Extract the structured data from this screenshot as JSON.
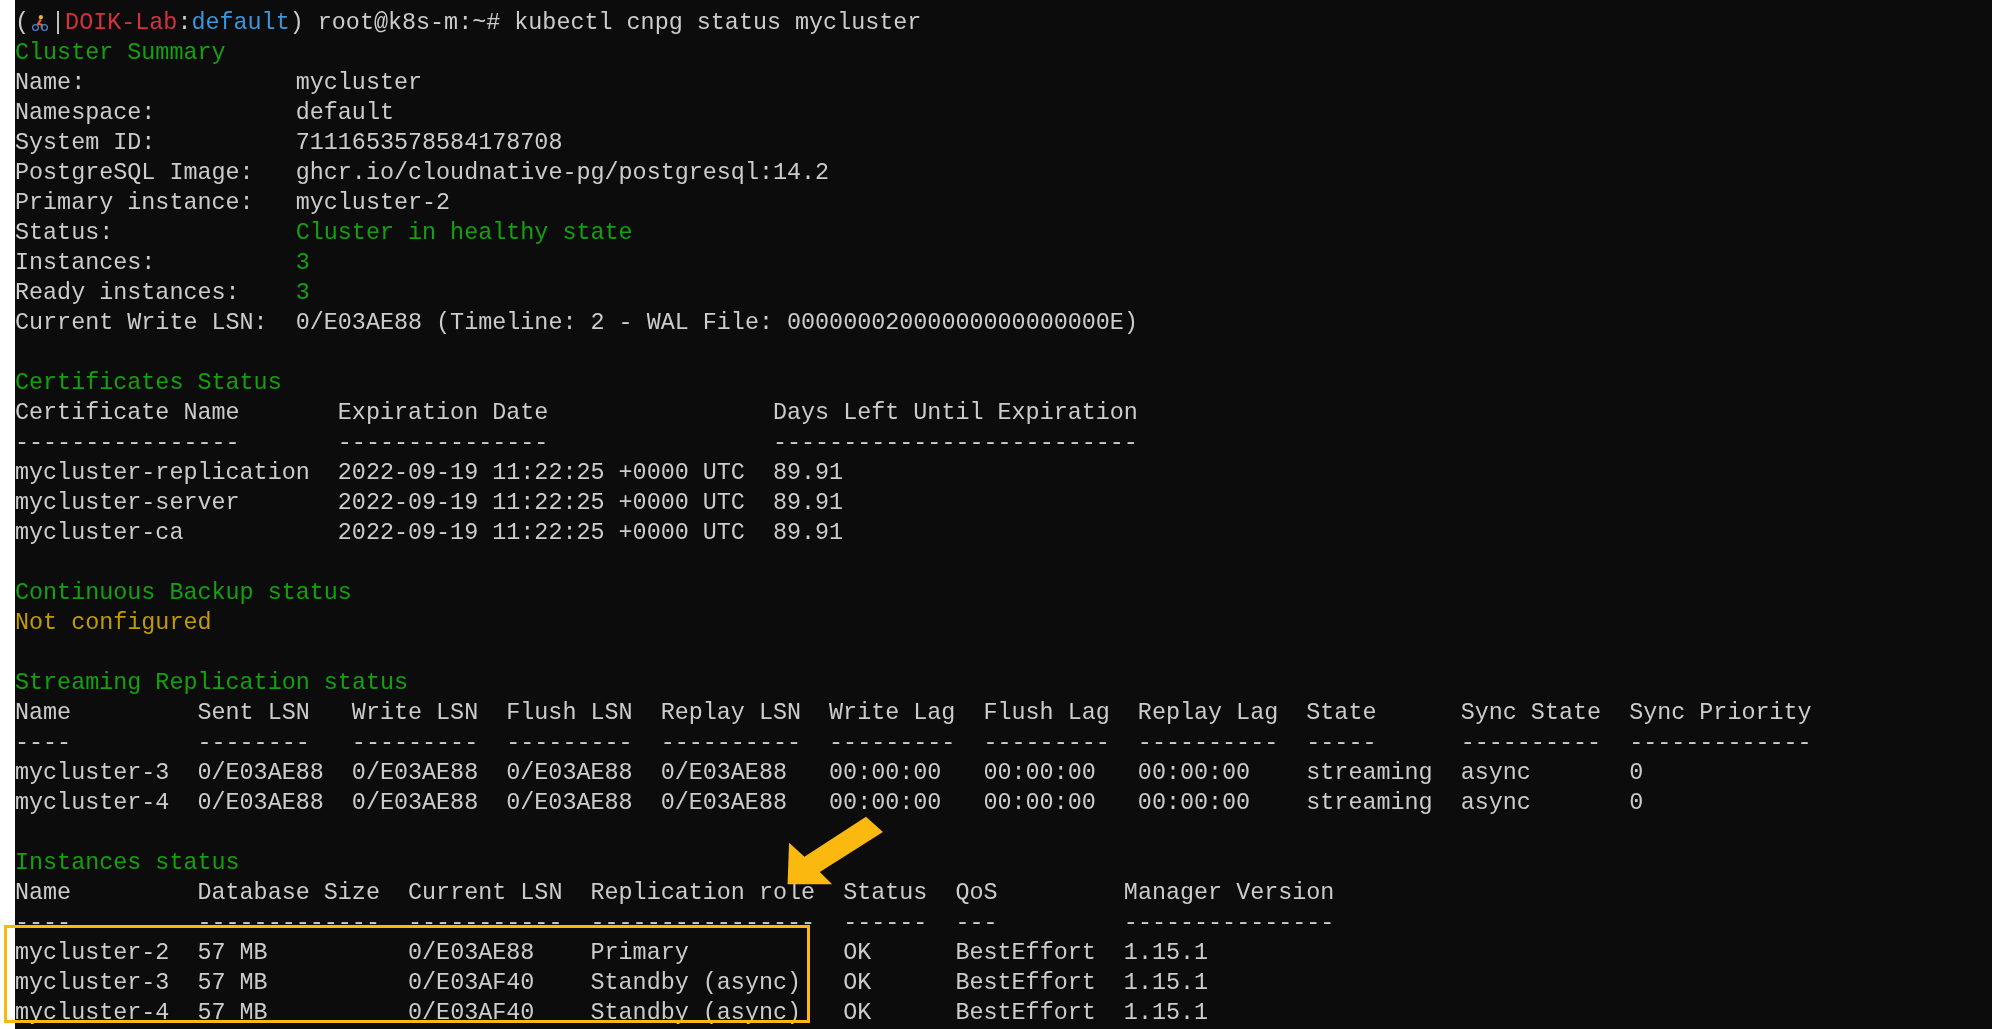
{
  "prompt": {
    "segments": [
      {
        "kind": "plain",
        "text": "("
      },
      {
        "kind": "icon"
      },
      {
        "kind": "plain",
        "text": "|"
      },
      {
        "kind": "host",
        "text": "DOIK-Lab"
      },
      {
        "kind": "plain",
        "text": ":"
      },
      {
        "kind": "namespace",
        "text": "default"
      },
      {
        "kind": "plain",
        "text": ") root@k8s-m:~# kubectl cnpg status mycluster"
      }
    ]
  },
  "sections": [
    {
      "title": "Cluster Summary",
      "kind": "fields",
      "fields": [
        {
          "label": "Name:",
          "value": "mycluster",
          "kind": "plain"
        },
        {
          "label": "Namespace:",
          "value": "default",
          "kind": "plain"
        },
        {
          "label": "System ID:",
          "value": "7111653578584178708",
          "kind": "plain"
        },
        {
          "label": "PostgreSQL Image:",
          "value": "ghcr.io/cloudnative-pg/postgresql:14.2",
          "kind": "plain"
        },
        {
          "label": "Primary instance:",
          "value": "mycluster-2",
          "kind": "plain"
        },
        {
          "label": "Status:",
          "value": "Cluster in healthy state",
          "kind": "good"
        },
        {
          "label": "Instances:",
          "value": "3",
          "kind": "good"
        },
        {
          "label": "Ready instances:",
          "value": "3",
          "kind": "good"
        },
        {
          "label": "Current Write LSN:",
          "value": "0/E03AE88 (Timeline: 2 - WAL File: 00000002000000000000000E)",
          "kind": "plain"
        }
      ]
    },
    {
      "title": "Certificates Status",
      "kind": "table",
      "columns": [
        {
          "label": "Certificate Name",
          "rule": "----------------"
        },
        {
          "label": "Expiration Date",
          "rule": "---------------"
        },
        {
          "label": "Days Left Until Expiration",
          "rule": "--------------------------"
        }
      ],
      "rows": [
        [
          "mycluster-replication",
          "2022-09-19 11:22:25 +0000 UTC",
          "89.91"
        ],
        [
          "mycluster-server",
          "2022-09-19 11:22:25 +0000 UTC",
          "89.91"
        ],
        [
          "mycluster-ca",
          "2022-09-19 11:22:25 +0000 UTC",
          "89.91"
        ]
      ]
    },
    {
      "title": "Continuous Backup status",
      "kind": "message",
      "message": {
        "text": "Not configured",
        "kind": "warning"
      }
    },
    {
      "title": "Streaming Replication status",
      "kind": "table",
      "columns": [
        {
          "label": "Name",
          "rule": "----"
        },
        {
          "label": "Sent LSN",
          "rule": "--------"
        },
        {
          "label": "Write LSN",
          "rule": "---------"
        },
        {
          "label": "Flush LSN",
          "rule": "---------"
        },
        {
          "label": "Replay LSN",
          "rule": "----------"
        },
        {
          "label": "Write Lag",
          "rule": "---------"
        },
        {
          "label": "Flush Lag",
          "rule": "---------"
        },
        {
          "label": "Replay Lag",
          "rule": "----------"
        },
        {
          "label": "State",
          "rule": "-----"
        },
        {
          "label": "Sync State",
          "rule": "----------"
        },
        {
          "label": "Sync Priority",
          "rule": "-------------"
        }
      ],
      "rows": [
        [
          "mycluster-3",
          "0/E03AE88",
          "0/E03AE88",
          "0/E03AE88",
          "0/E03AE88",
          "00:00:00",
          "00:00:00",
          "00:00:00",
          "streaming",
          "async",
          "0"
        ],
        [
          "mycluster-4",
          "0/E03AE88",
          "0/E03AE88",
          "0/E03AE88",
          "0/E03AE88",
          "00:00:00",
          "00:00:00",
          "00:00:00",
          "streaming",
          "async",
          "0"
        ]
      ]
    },
    {
      "title": "Instances status",
      "kind": "table",
      "columns": [
        {
          "label": "Name",
          "rule": "----"
        },
        {
          "label": "Database Size",
          "rule": "-------------"
        },
        {
          "label": "Current LSN",
          "rule": "-----------"
        },
        {
          "label": "Replication role",
          "rule": "----------------"
        },
        {
          "label": "Status",
          "rule": "------"
        },
        {
          "label": "QoS",
          "rule": "---"
        },
        {
          "label": "Manager Version",
          "rule": "---------------"
        }
      ],
      "rows": [
        [
          "mycluster-2",
          "57 MB",
          "0/E03AE88",
          "Primary",
          "OK",
          "BestEffort",
          "1.15.1"
        ],
        [
          "mycluster-3",
          "57 MB",
          "0/E03AF40",
          "Standby (async)",
          "OK",
          "BestEffort",
          "1.15.1"
        ],
        [
          "mycluster-4",
          "57 MB",
          "0/E03AF40",
          "Standby (async)",
          "OK",
          "BestEffort",
          "1.15.1"
        ]
      ]
    }
  ]
}
